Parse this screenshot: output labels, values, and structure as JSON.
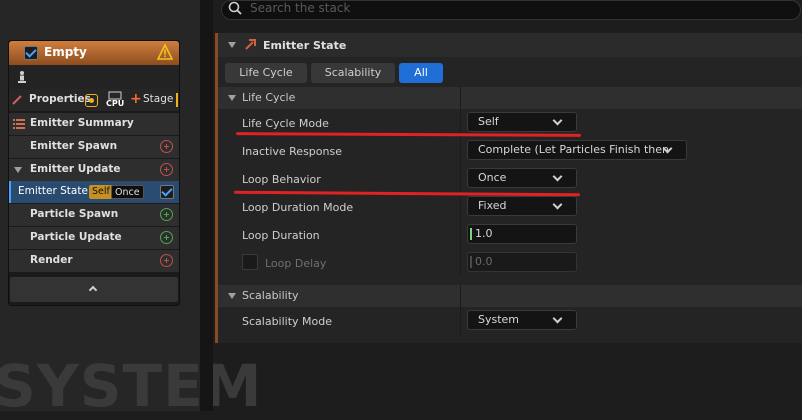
{
  "watermark": "SYSTEM",
  "node": {
    "title": "Empty",
    "properties_label": "Properties",
    "cpu_label": "CPU",
    "stage_label": "Stage",
    "items": [
      {
        "label": "Emitter Summary"
      },
      {
        "label": "Emitter Spawn"
      },
      {
        "label": "Emitter Update"
      },
      {
        "label": "Emitter State",
        "badge1": "Self",
        "badge2": "Once"
      },
      {
        "label": "Particle Spawn"
      },
      {
        "label": "Particle Update"
      },
      {
        "label": "Render"
      }
    ]
  },
  "search": {
    "placeholder": "Search the stack"
  },
  "panel": {
    "title": "Emitter State",
    "tabs": [
      {
        "label": "Life Cycle"
      },
      {
        "label": "Scalability"
      },
      {
        "label": "All",
        "active": true
      }
    ],
    "sections": [
      {
        "title": "Life Cycle",
        "rows": [
          {
            "label": "Life Cycle Mode",
            "value": "Self"
          },
          {
            "label": "Inactive Response",
            "value": "Complete (Let Particles Finish then"
          },
          {
            "label": "Loop Behavior",
            "value": "Once"
          },
          {
            "label": "Loop Duration Mode",
            "value": "Fixed"
          },
          {
            "label": "Loop Duration",
            "value": "1.0"
          },
          {
            "label": "Loop Delay",
            "value": "0.0"
          }
        ]
      },
      {
        "title": "Scalability",
        "rows": [
          {
            "label": "Scalability Mode",
            "value": "System"
          }
        ]
      }
    ]
  },
  "colors": {
    "accent": "#1f6fd6",
    "emitter_header": "#cf7e3e",
    "highlight_underline": "#e02222",
    "enabled_check": "#4aa0ff"
  }
}
